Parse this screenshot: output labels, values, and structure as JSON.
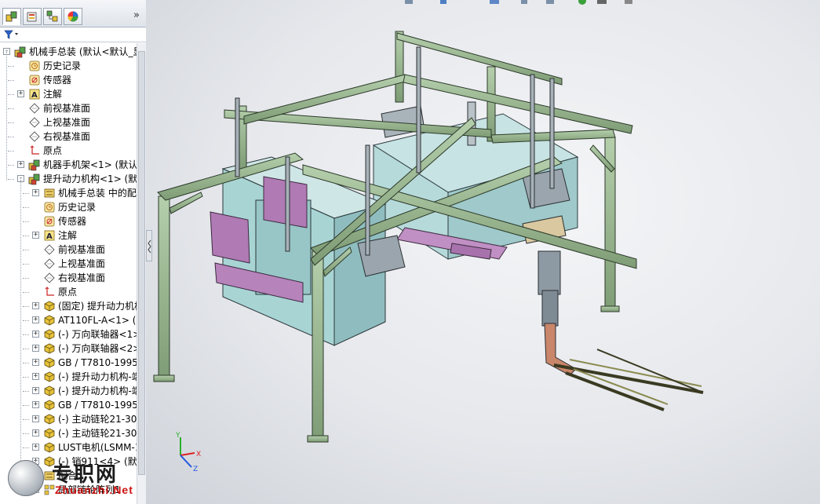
{
  "panel": {
    "tabs": [
      {
        "name": "feature-manager",
        "icon": "assembly-icon"
      },
      {
        "name": "property-manager",
        "icon": "property-icon"
      },
      {
        "name": "configuration-manager",
        "icon": "configuration-icon"
      },
      {
        "name": "display-manager",
        "icon": "appearance-icon"
      }
    ],
    "more_label": "»",
    "filter_icon": "filter-icon"
  },
  "tree": [
    {
      "label": "机械手总装  (默认<默认_显示",
      "icon": "assembly",
      "level": 0,
      "expander": "-"
    },
    {
      "label": "历史记录",
      "icon": "history",
      "level": 1,
      "expander": ""
    },
    {
      "label": "传感器",
      "icon": "sensor",
      "level": 1,
      "expander": ""
    },
    {
      "label": "注解",
      "icon": "annotation",
      "level": 1,
      "expander": "+"
    },
    {
      "label": "前视基准面",
      "icon": "plane",
      "level": 1,
      "expander": ""
    },
    {
      "label": "上视基准面",
      "icon": "plane",
      "level": 1,
      "expander": ""
    },
    {
      "label": "右视基准面",
      "icon": "plane",
      "level": 1,
      "expander": ""
    },
    {
      "label": "原点",
      "icon": "origin",
      "level": 1,
      "expander": ""
    },
    {
      "label": "机器手机架<1> (默认<显",
      "icon": "assembly",
      "level": 1,
      "expander": "+"
    },
    {
      "label": "提升动力机构<1> (默认",
      "icon": "assembly",
      "level": 1,
      "expander": "-"
    },
    {
      "label": "机械手总装 中的配合",
      "icon": "mates",
      "level": 2,
      "expander": "+"
    },
    {
      "label": "历史记录",
      "icon": "history",
      "level": 2,
      "expander": ""
    },
    {
      "label": "传感器",
      "icon": "sensor",
      "level": 2,
      "expander": ""
    },
    {
      "label": "注解",
      "icon": "annotation",
      "level": 2,
      "expander": "+"
    },
    {
      "label": "前视基准面",
      "icon": "plane",
      "level": 2,
      "expander": ""
    },
    {
      "label": "上视基准面",
      "icon": "plane",
      "level": 2,
      "expander": ""
    },
    {
      "label": "右视基准面",
      "icon": "plane",
      "level": 2,
      "expander": ""
    },
    {
      "label": "原点",
      "icon": "origin",
      "level": 2,
      "expander": ""
    },
    {
      "label": "(固定) 提升动力机构-",
      "icon": "part",
      "level": 2,
      "expander": "+"
    },
    {
      "label": "AT110FL-A<1> (默认",
      "icon": "part",
      "level": 2,
      "expander": "+"
    },
    {
      "label": "(-) 万向联轴器<1> (",
      "icon": "part",
      "level": 2,
      "expander": "+"
    },
    {
      "label": "(-) 万向联轴器<2> (",
      "icon": "part",
      "level": 2,
      "expander": "+"
    },
    {
      "label": "GB / T7810-1995带",
      "icon": "part",
      "level": 2,
      "expander": "+"
    },
    {
      "label": "(-) 提升动力机构-端部",
      "icon": "part",
      "level": 2,
      "expander": "+"
    },
    {
      "label": "(-) 提升动力机构-端部",
      "icon": "part",
      "level": 2,
      "expander": "+"
    },
    {
      "label": "GB / T7810-1995带",
      "icon": "part",
      "level": 2,
      "expander": "+"
    },
    {
      "label": "(-) 主动链轮21-30-20",
      "icon": "part",
      "level": 2,
      "expander": "+"
    },
    {
      "label": "(-) 主动链轮21-30-20",
      "icon": "part",
      "level": 2,
      "expander": "+"
    },
    {
      "label": "LUST电机(LSMM-13",
      "icon": "part",
      "level": 2,
      "expander": "+"
    },
    {
      "label": "(-) 销911<4> (默认<",
      "icon": "part",
      "level": 2,
      "expander": "+"
    },
    {
      "label": "配合",
      "icon": "mates",
      "level": 2,
      "expander": "+"
    },
    {
      "label": "局部链轮阵列1",
      "icon": "pattern",
      "level": 2,
      "expander": "+"
    }
  ],
  "triad": {
    "x": "X",
    "y": "Y",
    "z": "Z"
  },
  "watermark": {
    "cn": "专职网",
    "en": "Zhuanzhi.Net"
  },
  "colors": {
    "frame_green": "#8fae85",
    "frame_edge": "#2d3a2b",
    "panel_cyan": "#a8d4d4",
    "purple_part": "#b07ab4",
    "copper_pipe": "#c9866a",
    "gray_machine": "#8e9aa3"
  }
}
